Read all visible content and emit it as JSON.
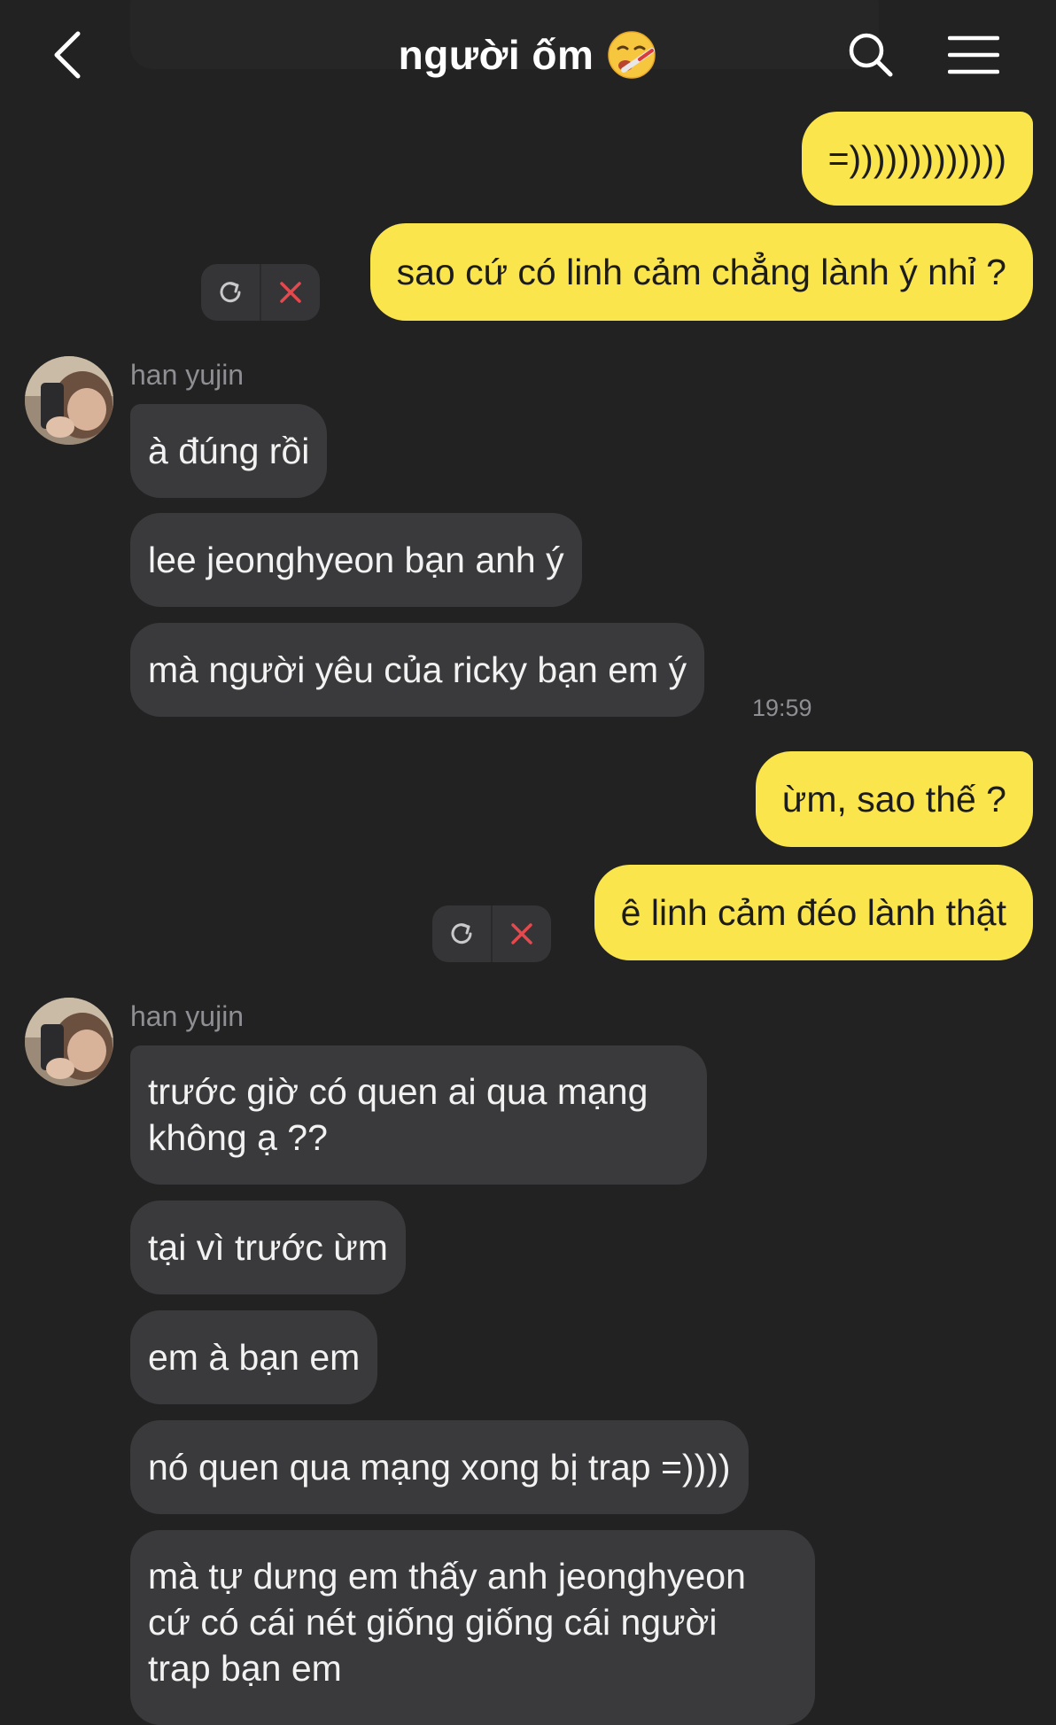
{
  "header": {
    "title": "người ốm",
    "title_emoji": "🤒",
    "back_icon": "chevron-left-icon",
    "search_icon": "search-icon",
    "menu_icon": "hamburger-menu-icon"
  },
  "colors": {
    "background": "#222223",
    "outgoing_bubble": "#fbe54d",
    "incoming_bubble": "#3a3a3c",
    "error_icon": "#e5484d"
  },
  "messages": [
    {
      "id": "m1",
      "direction": "out",
      "text": "=)))))))))))))"
    },
    {
      "id": "m2",
      "direction": "out",
      "text": "sao cứ có linh cảm chẳng lành ý nhỉ ?",
      "failed": true
    },
    {
      "id": "m3",
      "direction": "in",
      "sender": "han yujin",
      "text": "à đúng rồi"
    },
    {
      "id": "m4",
      "direction": "in",
      "text": "lee jeonghyeon bạn anh ý"
    },
    {
      "id": "m5",
      "direction": "in",
      "text": "mà người yêu của ricky bạn em ý",
      "time": "19:59"
    },
    {
      "id": "m6",
      "direction": "out",
      "text": "ừm, sao thế ?"
    },
    {
      "id": "m7",
      "direction": "out",
      "text": "ê linh cảm đéo lành thật",
      "failed": true
    },
    {
      "id": "m8",
      "direction": "in",
      "sender": "han yujin",
      "lines": [
        "trước giờ có quen ai qua mạng",
        "không ạ ??"
      ]
    },
    {
      "id": "m9",
      "direction": "in",
      "text": "tại vì trước ừm"
    },
    {
      "id": "m10",
      "direction": "in",
      "text": "em à bạn em"
    },
    {
      "id": "m11",
      "direction": "in",
      "text": "nó quen qua mạng xong bị trap =))))"
    },
    {
      "id": "m12",
      "direction": "in",
      "lines": [
        "mà tự dưng em thấy anh jeonghyeon",
        "cứ có cái nét giống giống cái người",
        "trap bạn em"
      ]
    }
  ]
}
